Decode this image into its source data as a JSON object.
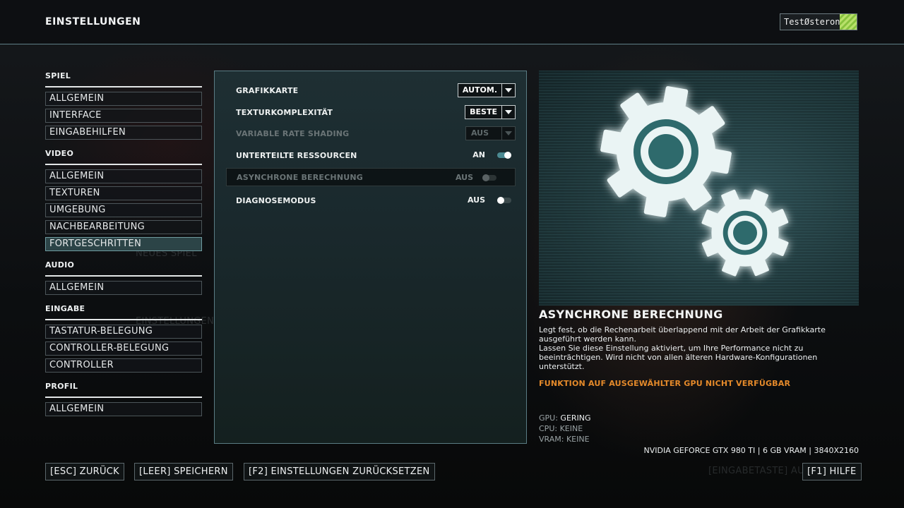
{
  "header": {
    "title": "EINSTELLUNGEN",
    "user_name": "TestØsteron"
  },
  "nav": {
    "sections": [
      {
        "heading": "SPIEL",
        "items": [
          "ALLGEMEIN",
          "INTERFACE",
          "EINGABEHILFEN"
        ]
      },
      {
        "heading": "VIDEO",
        "items": [
          "ALLGEMEIN",
          "TEXTUREN",
          "UMGEBUNG",
          "NACHBEARBEITUNG",
          "FORTGESCHRITTEN"
        ]
      },
      {
        "heading": "AUDIO",
        "items": [
          "ALLGEMEIN"
        ]
      },
      {
        "heading": "EINGABE",
        "items": [
          "TASTATUR-BELEGUNG",
          "CONTROLLER-BELEGUNG",
          "CONTROLLER"
        ]
      },
      {
        "heading": "PROFIL",
        "items": [
          "ALLGEMEIN"
        ]
      }
    ],
    "active": "VIDEO / FORTGESCHRITTEN"
  },
  "settings": [
    {
      "label": "GRAFIKKARTE",
      "type": "dropdown",
      "value": "AUTOM.",
      "enabled": true
    },
    {
      "label": "TEXTURKOMPLEXITÄT",
      "type": "dropdown",
      "value": "BESTE",
      "enabled": true
    },
    {
      "label": "VARIABLE RATE SHADING",
      "type": "dropdown",
      "value": "AUS",
      "enabled": false
    },
    {
      "label": "UNTERTEILTE RESSOURCEN",
      "type": "toggle",
      "value": "AN",
      "on": true,
      "enabled": true
    },
    {
      "label": "ASYNCHRONE BERECHNUNG",
      "type": "toggle",
      "value": "AUS",
      "on": false,
      "enabled": false,
      "selected": true
    },
    {
      "label": "DIAGNOSEMODUS",
      "type": "toggle",
      "value": "AUS",
      "on": false,
      "enabled": true
    }
  ],
  "info": {
    "image_icon": "gears-icon",
    "title": "ASYNCHRONE BERECHNUNG",
    "description_1": "Legt fest, ob die Rechenarbeit überlappend mit der Arbeit der Grafikkarte ausgeführt werden kann.",
    "description_2": "Lassen Sie diese Einstellung aktiviert, um Ihre Performance nicht zu beeinträchtigen. Wird nicht von allen älteren Hardware-Konfigurationen unterstützt.",
    "warning": "FUNKTION AUF AUSGEWÄHLTER GPU NICHT VERFÜGBAR",
    "impact": [
      {
        "label": "GPU:",
        "value": "GERING"
      },
      {
        "label": "CPU:",
        "value": "KEINE"
      },
      {
        "label": "VRAM:",
        "value": "KEINE"
      }
    ],
    "hardware": "NVIDIA GEFORCE GTX 980 TI | 6 GB VRAM | 3840X2160"
  },
  "footer": {
    "back": "[ESC] ZURÜCK",
    "save": "[LEER] SPEICHERN",
    "reset": "[F2] EINSTELLUNGEN ZURÜCKSETZEN",
    "help": "[F1] HILFE",
    "ghost_enter": "[EINGABETASTE] AU"
  },
  "colors": {
    "accent": "#4b8a92",
    "warning": "#e58a2a",
    "active_nav": "#2c4447"
  }
}
